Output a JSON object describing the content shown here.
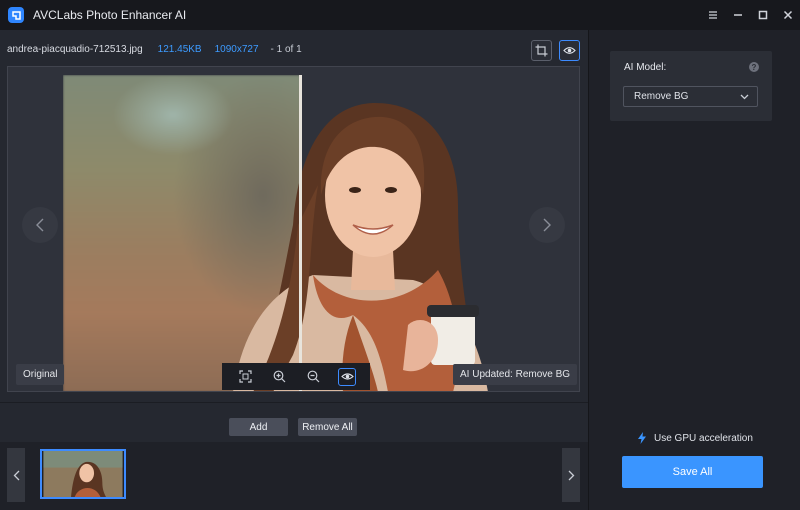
{
  "app": {
    "title": "AVCLabs Photo Enhancer AI"
  },
  "window_controls": [
    "menu-icon",
    "minimize-icon",
    "maximize-icon",
    "close-icon"
  ],
  "file": {
    "name": "andrea-piacquadio-712513.jpg",
    "size": "121.45KB",
    "dimensions": "1090x727",
    "count": "- 1 of 1"
  },
  "preview": {
    "original_label": "Original",
    "updated_label": "AI Updated: Remove BG",
    "toolbar_icons": [
      "fit-screen-icon",
      "zoom-in-icon",
      "zoom-out-icon",
      "eye-icon"
    ]
  },
  "actions": {
    "add_label": "Add",
    "remove_all_label": "Remove All"
  },
  "sidebar": {
    "model_label": "AI Model:",
    "model_help": "?",
    "model_selected": "Remove BG",
    "gpu_label": "Use GPU acceleration",
    "save_label": "Save All"
  },
  "colors": {
    "accent": "#3a95ff",
    "bg_dark": "#1f2128",
    "panel": "#252830"
  }
}
